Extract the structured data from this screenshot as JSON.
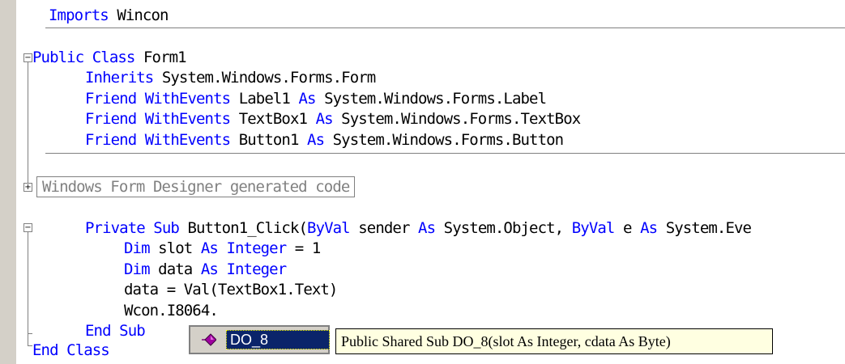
{
  "colors": {
    "keyword": "#0000ff",
    "text": "#000000",
    "margin": "#d4d0c8",
    "selection": "#0a246a",
    "tooltip_bg": "#ffffe1",
    "region": "#808080"
  },
  "code": {
    "l1_kw": "Imports",
    "l1_rest": " Wincon",
    "l2_kw1": "Public Class",
    "l2_rest": " Form1",
    "l3_kw": "Inherits",
    "l3_rest": " System.Windows.Forms.Form",
    "l4_kw": "Friend WithEvents",
    "l4_mid": " Label1 ",
    "l4_kw2": "As",
    "l4_rest": " System.Windows.Forms.Label",
    "l5_kw": "Friend WithEvents",
    "l5_mid": " TextBox1 ",
    "l5_kw2": "As",
    "l5_rest": " System.Windows.Forms.TextBox",
    "l6_kw": "Friend WithEvents",
    "l6_mid": " Button1 ",
    "l6_kw2": "As",
    "l6_rest": " System.Windows.Forms.Button",
    "region_label": "Windows Form Designer generated code",
    "l8_kw": "Private Sub",
    "l8_a": " Button1_Click(",
    "l8_kw2": "ByVal",
    "l8_b": " sender ",
    "l8_kw3": "As",
    "l8_c": " System.Object, ",
    "l8_kw4": "ByVal",
    "l8_d": " e ",
    "l8_kw5": "As",
    "l8_e": " System.Eve",
    "l9_kw": "Dim",
    "l9_a": " slot ",
    "l9_kw2": "As Integer",
    "l9_b": " = 1",
    "l10_kw": "Dim",
    "l10_a": " data ",
    "l10_kw2": "As Integer",
    "l11": "data = Val(TextBox1.Text)",
    "l12": "Wcon.I8064.",
    "l13_kw": "End Sub",
    "l14_kw": "End Class"
  },
  "completion": {
    "icon": "method-icon",
    "selected_item": "DO_8"
  },
  "tooltip": {
    "text": "Public Shared Sub DO_8(slot As Integer, cdata As Byte)"
  }
}
